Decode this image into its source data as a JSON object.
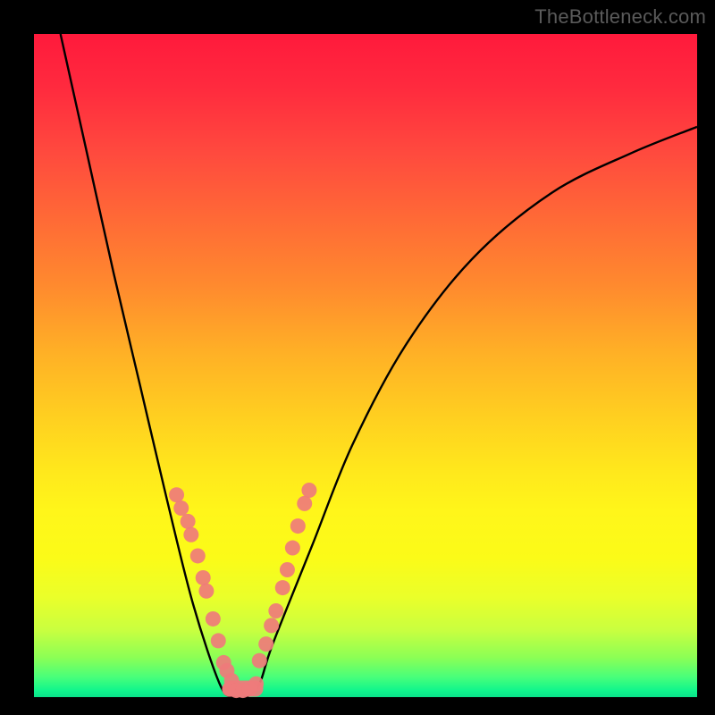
{
  "watermark": "TheBottleneck.com",
  "chart_data": {
    "type": "line",
    "title": "",
    "xlabel": "",
    "ylabel": "",
    "xlim": [
      0,
      1
    ],
    "ylim": [
      0,
      1
    ],
    "grid": false,
    "legend": false,
    "series": [
      {
        "name": "curve",
        "color": "#000000",
        "x": [
          0.04,
          0.08,
          0.12,
          0.16,
          0.2,
          0.24,
          0.28,
          0.3,
          0.32,
          0.34,
          0.36,
          0.42,
          0.48,
          0.56,
          0.66,
          0.78,
          0.9,
          1.0
        ],
        "y": [
          1.0,
          0.82,
          0.64,
          0.47,
          0.3,
          0.14,
          0.02,
          0.0,
          0.0,
          0.02,
          0.08,
          0.23,
          0.38,
          0.53,
          0.66,
          0.76,
          0.82,
          0.86
        ]
      },
      {
        "name": "points-left",
        "type": "scatter",
        "color": "#ef7b7b",
        "x": [
          0.215,
          0.222,
          0.232,
          0.237,
          0.247,
          0.255,
          0.26,
          0.27,
          0.278,
          0.286,
          0.291,
          0.298
        ],
        "y": [
          0.305,
          0.285,
          0.265,
          0.245,
          0.213,
          0.18,
          0.16,
          0.118,
          0.085,
          0.052,
          0.04,
          0.025
        ]
      },
      {
        "name": "points-right",
        "type": "scatter",
        "color": "#ef7b7b",
        "x": [
          0.34,
          0.35,
          0.358,
          0.365,
          0.375,
          0.382,
          0.39,
          0.398,
          0.408,
          0.415
        ],
        "y": [
          0.055,
          0.08,
          0.108,
          0.13,
          0.165,
          0.192,
          0.225,
          0.258,
          0.292,
          0.312
        ]
      },
      {
        "name": "points-bottom",
        "type": "scatter",
        "color": "#ef7b7b",
        "x": [
          0.295,
          0.305,
          0.315,
          0.325,
          0.335
        ],
        "y": [
          0.012,
          0.01,
          0.01,
          0.012,
          0.02
        ]
      }
    ],
    "gradient_stops": [
      {
        "pos": 0.0,
        "color": "#ff1a3c"
      },
      {
        "pos": 0.5,
        "color": "#ffd020"
      },
      {
        "pos": 0.8,
        "color": "#fbfb18"
      },
      {
        "pos": 0.95,
        "color": "#8cff55"
      },
      {
        "pos": 1.0,
        "color": "#0ae28a"
      }
    ]
  }
}
